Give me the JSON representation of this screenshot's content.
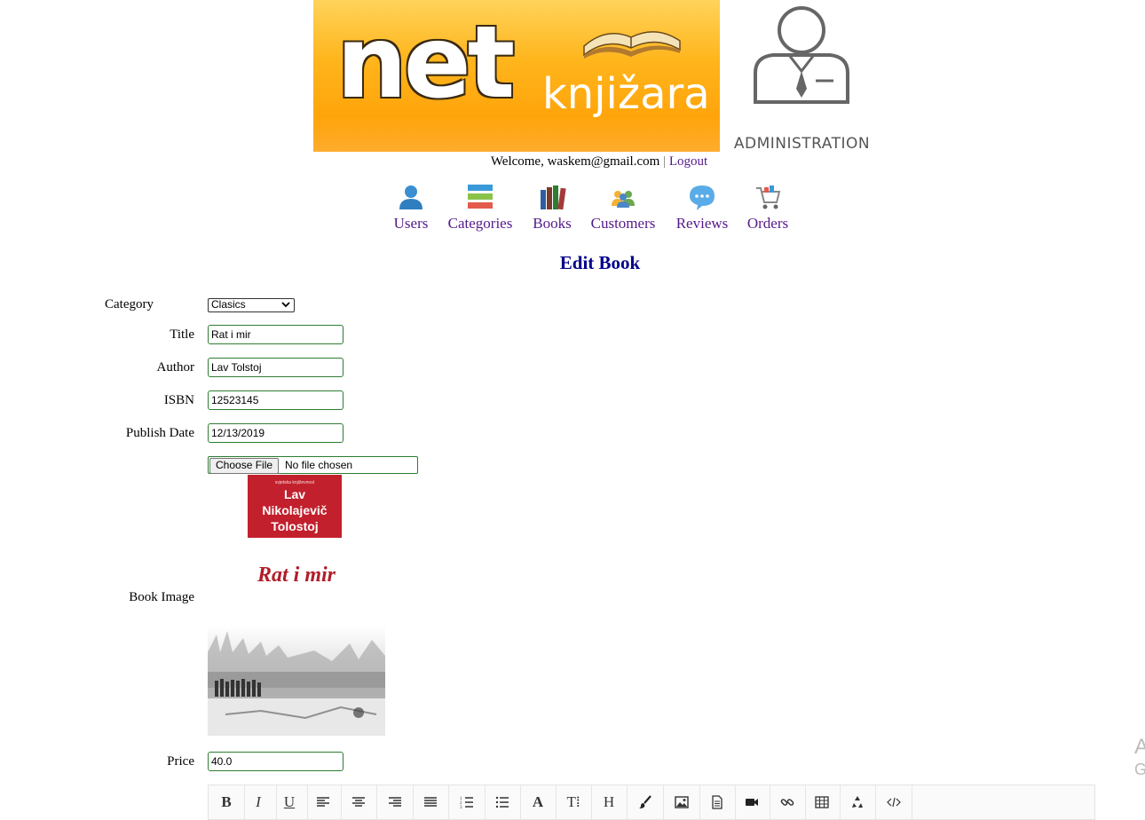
{
  "header": {
    "logo_text_main": "net",
    "logo_text_sub": "knjižara",
    "admin_label": "ADMINISTRATION"
  },
  "welcome": {
    "prefix": "Welcome, waskem@gmail.com",
    "separator": "|",
    "logout_label": "Logout"
  },
  "nav": {
    "items": [
      {
        "label": "Users",
        "icon": "user-icon"
      },
      {
        "label": "Categories",
        "icon": "categories-icon"
      },
      {
        "label": "Books",
        "icon": "books-icon"
      },
      {
        "label": "Customers",
        "icon": "customers-icon"
      },
      {
        "label": "Reviews",
        "icon": "reviews-icon"
      },
      {
        "label": "Orders",
        "icon": "cart-icon"
      }
    ]
  },
  "page_title": "Edit Book",
  "form": {
    "category_label": "Category",
    "category_value": "Clasics",
    "title_label": "Title",
    "title_value": "Rat i mir",
    "author_label": "Author",
    "author_value": "Lav Tolstoj",
    "isbn_label": "ISBN",
    "isbn_value": "12523145",
    "publish_date_label": "Publish Date",
    "publish_date_value": "12/13/2019",
    "image_label": "Book Image",
    "file_button_label": "Choose File",
    "file_status": "No file chosen",
    "cover": {
      "publisher_line": "svjetska književnost",
      "author_line1": "Lav",
      "author_line2": "Nikolajevič",
      "author_line3": "Tolostoj",
      "title": "Rat i mir"
    },
    "price_label": "Price",
    "price_value": "40.0"
  },
  "editor_toolbar": {
    "buttons": [
      "bold-button",
      "italic-button",
      "underline-button",
      "align-left-button",
      "align-center-button",
      "align-right-button",
      "justify-button",
      "ordered-list-button",
      "unordered-list-button",
      "font-color-button",
      "font-size-button",
      "heading-button",
      "brush-button",
      "image-button",
      "document-button",
      "video-button",
      "link-button",
      "table-button",
      "recycle-button",
      "code-view-button"
    ],
    "labels": {
      "bold": "B",
      "italic": "I",
      "underline": "U",
      "font": "A",
      "size": "T⁞",
      "heading": "H"
    }
  },
  "corner_glyphs": {
    "top": "A",
    "bottom": "G"
  },
  "colors": {
    "link": "#551a8b",
    "title": "#00008b",
    "input_border": "#2e7d32",
    "banner": "#ffa800"
  }
}
